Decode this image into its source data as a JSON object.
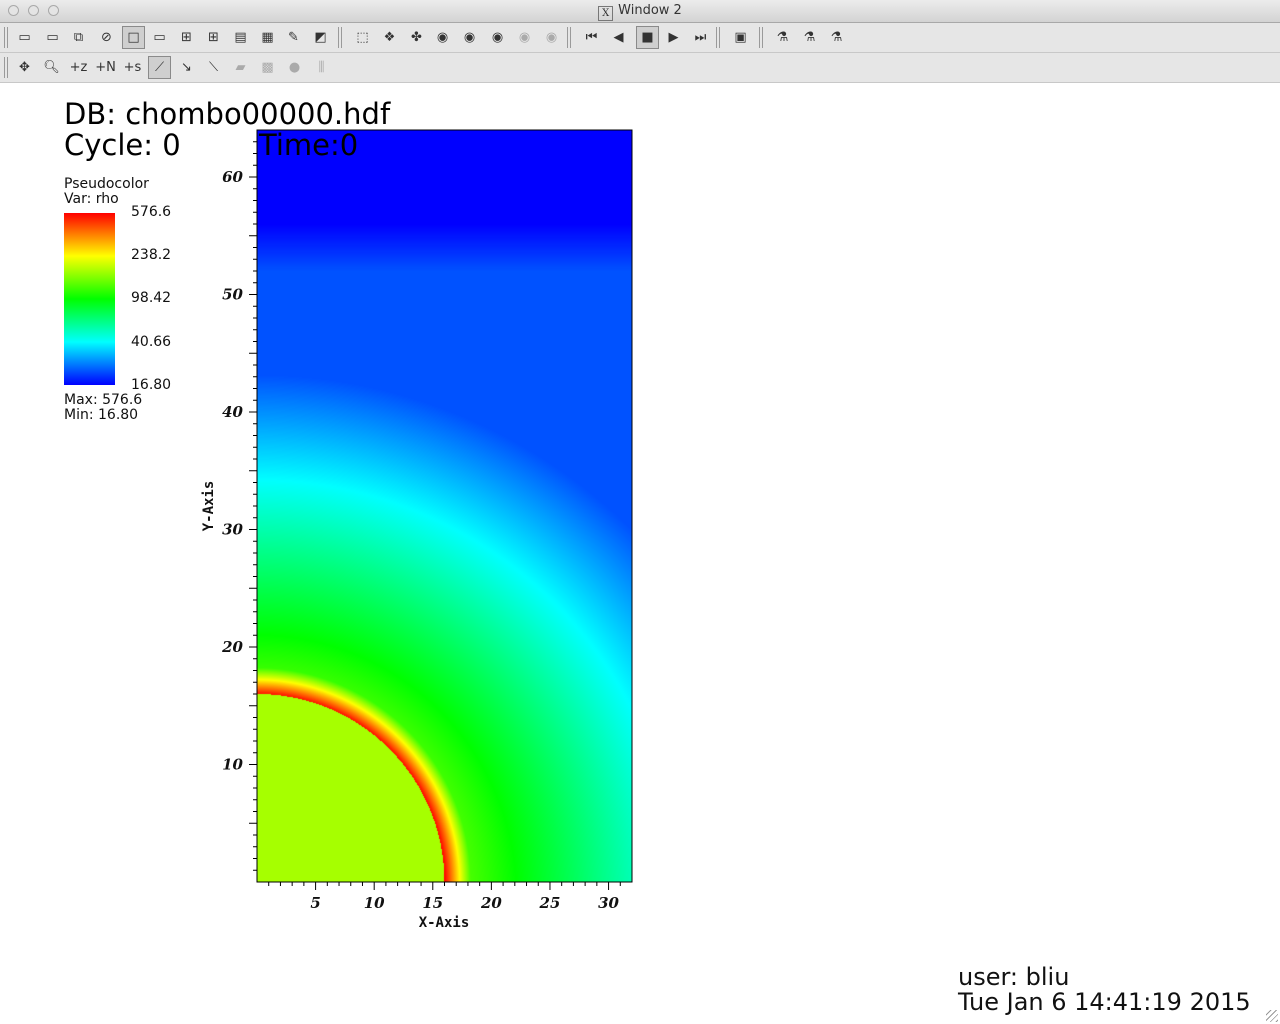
{
  "window": {
    "title": "Window 2"
  },
  "toolbar1": {
    "buttons": [
      {
        "name": "new-window-icon",
        "glyph": "▭"
      },
      {
        "name": "clone-window-icon",
        "glyph": "▭"
      },
      {
        "name": "copy-window-icon",
        "glyph": "⧉"
      },
      {
        "name": "delete-window-icon",
        "glyph": "⊘"
      },
      {
        "name": "layout-1x1-icon",
        "glyph": "□"
      },
      {
        "name": "layout-1x2-icon",
        "glyph": "▭"
      },
      {
        "name": "layout-2x2-icon",
        "glyph": "⊞"
      },
      {
        "name": "layout-2x3-icon",
        "glyph": "⊞"
      },
      {
        "name": "layout-2x4-icon",
        "glyph": "▤"
      },
      {
        "name": "layout-3x3-icon",
        "glyph": "▦"
      },
      {
        "name": "lock-view-icon",
        "glyph": "✎"
      },
      {
        "name": "spin-mode-icon",
        "glyph": "◩"
      },
      {
        "name": "invert-background-icon",
        "glyph": "⬚"
      },
      {
        "name": "camera-1-icon",
        "glyph": "❖"
      },
      {
        "name": "camera-2-icon",
        "glyph": "✤"
      },
      {
        "name": "camera-3-icon",
        "glyph": "◉"
      },
      {
        "name": "camera-4-icon",
        "glyph": "◉"
      },
      {
        "name": "camera-5-icon",
        "glyph": "◉"
      },
      {
        "name": "camera-6-icon",
        "glyph": "◉"
      },
      {
        "name": "camera-7-icon",
        "glyph": "◉"
      },
      {
        "name": "reverse-step-icon",
        "glyph": "⏮"
      },
      {
        "name": "reverse-play-icon",
        "glyph": "◀"
      },
      {
        "name": "stop-icon",
        "glyph": "■"
      },
      {
        "name": "play-icon",
        "glyph": "▶"
      },
      {
        "name": "forward-step-icon",
        "glyph": "⏭"
      },
      {
        "name": "plot-list-icon",
        "glyph": "▣"
      },
      {
        "name": "user-1-icon",
        "glyph": "⚗"
      },
      {
        "name": "user-2-icon",
        "glyph": "⚗"
      },
      {
        "name": "user-3-icon",
        "glyph": "⚗"
      }
    ]
  },
  "toolbar2": {
    "buttons": [
      {
        "name": "navigate-mode-icon",
        "glyph": "✥"
      },
      {
        "name": "zoom-mode-icon",
        "glyph": "🔍︎"
      },
      {
        "name": "zone-pick-icon",
        "glyph": "+z"
      },
      {
        "name": "node-pick-icon",
        "glyph": "+N"
      },
      {
        "name": "spreadsheet-pick-icon",
        "glyph": "+s"
      },
      {
        "name": "curve-pick-icon",
        "glyph": "⟋"
      },
      {
        "name": "lineout-icon",
        "glyph": "↘"
      },
      {
        "name": "line-tool-icon",
        "glyph": "⟍"
      },
      {
        "name": "plane-tool-icon",
        "glyph": "▰"
      },
      {
        "name": "box-tool-icon",
        "glyph": "▩"
      },
      {
        "name": "sphere-tool-icon",
        "glyph": "●"
      },
      {
        "name": "axis-restriction-icon",
        "glyph": "⫼"
      }
    ]
  },
  "annotation": {
    "db": "DB: chombo00000.hdf",
    "cycle": "Cycle: 0",
    "time": "Time:0",
    "user": "user: bliu",
    "date": "Tue Jan  6 14:41:19 2015"
  },
  "legend": {
    "plot_type": "Pseudocolor",
    "var": "Var: rho",
    "ticks": [
      "576.6",
      "238.2",
      "98.42",
      "40.66",
      "16.80"
    ],
    "max": "Max:  576.6",
    "min": "Min:  16.80",
    "colors": [
      "#ff0000",
      "#ffff00",
      "#00ff00",
      "#00ffff",
      "#0000ff"
    ]
  },
  "plot": {
    "x_axis_title": "X-Axis",
    "y_axis_title": "Y-Axis",
    "x_ticks": [
      "5",
      "10",
      "15",
      "20",
      "25",
      "30"
    ],
    "y_ticks": [
      "10",
      "20",
      "30",
      "40",
      "50",
      "60"
    ],
    "x_range": [
      0,
      32
    ],
    "y_range": [
      0,
      64
    ],
    "obstacle_color": "#a6ff00"
  }
}
